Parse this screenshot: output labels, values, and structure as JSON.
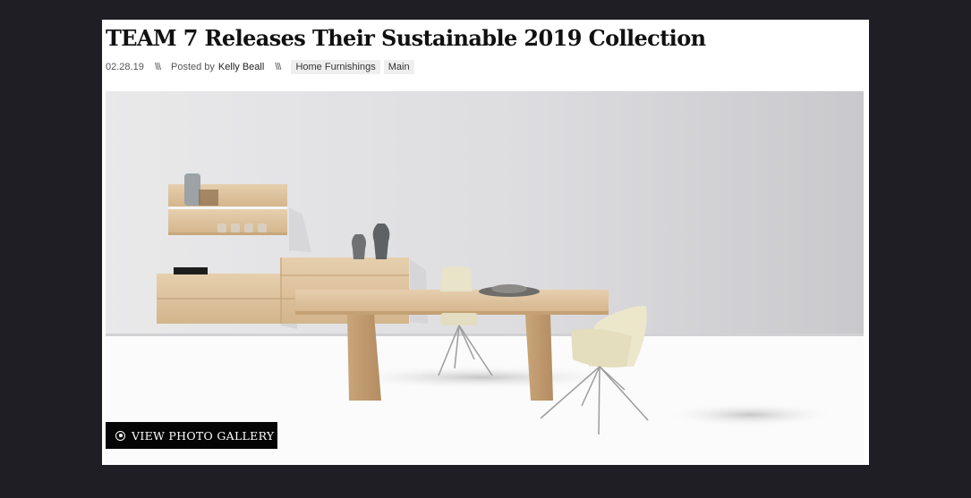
{
  "article": {
    "title": "TEAM 7 Releases Their Sustainable 2019 Collection",
    "date": "02.28.19",
    "separator": "\\\\\\",
    "posted_by_label": "Posted by",
    "author": "Kelly Beall",
    "tags": [
      "Home Furnishings",
      "Main"
    ]
  },
  "hero": {
    "gallery_button_label": "VIEW PHOTO GALLERY",
    "gallery_button_icon": "play-circle-icon"
  },
  "colors": {
    "page_background": "#1f1e24",
    "card_background": "#ffffff",
    "button_background": "#050505"
  }
}
